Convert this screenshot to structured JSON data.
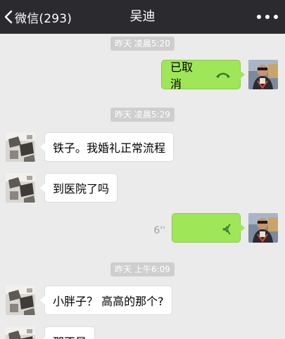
{
  "navbar": {
    "back_label": "微信(293)",
    "title": "吴迪",
    "back_icon": "chevron-left-icon",
    "more_icon": "more-dots-icon"
  },
  "messages": {
    "ts1": "昨天 凌晨5:20",
    "call_cancelled": "已取消",
    "ts2": "昨天 凌晨5:29",
    "msg1": "铁子。我婚礼正常流程",
    "msg2": "到医院了吗",
    "voice_duration": "6''",
    "ts3": "昨天 上午6:09",
    "msg3": "小胖子？ 高高的那个?",
    "msg4": "那不是"
  },
  "colors": {
    "navbar_bg": "#2b2b2f",
    "chat_bg": "#ebebeb",
    "out_bubble": "#9fe658",
    "in_bubble": "#ffffff",
    "timestamp_bg": "#cecece"
  }
}
